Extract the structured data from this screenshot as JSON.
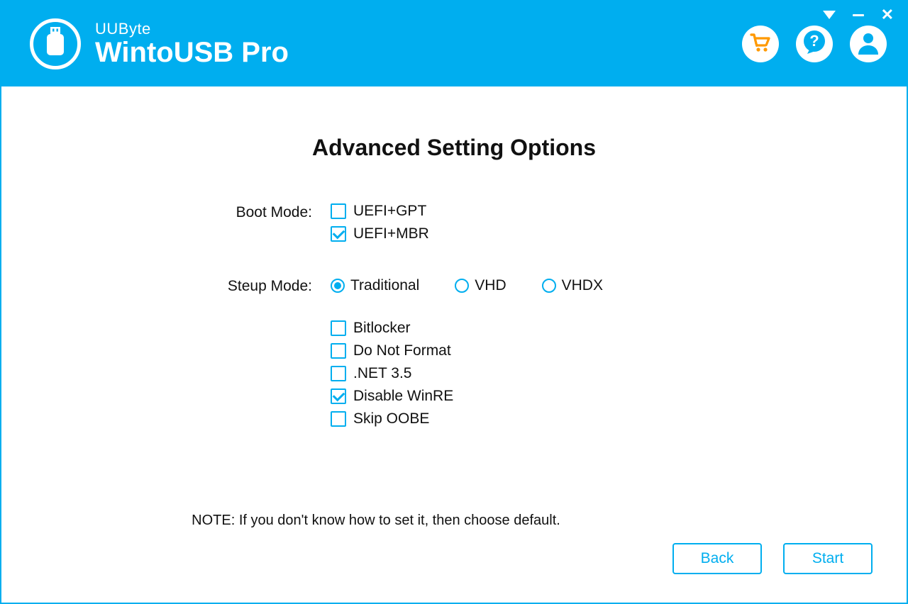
{
  "brand": {
    "company": "UUByte",
    "product": "WintoUSB Pro"
  },
  "colors": {
    "brand": "#00aeef",
    "cart": "#ff9900"
  },
  "page": {
    "title": "Advanced Setting Options",
    "note": "NOTE: If you don't know how to set it, then choose default."
  },
  "labels": {
    "boot_mode": "Boot Mode:",
    "setup_mode": "Steup Mode:"
  },
  "boot_mode": {
    "options": [
      {
        "key": "uefi_gpt",
        "label": "UEFI+GPT",
        "checked": false
      },
      {
        "key": "uefi_mbr",
        "label": "UEFI+MBR",
        "checked": true
      }
    ]
  },
  "setup_mode": {
    "selected": "traditional",
    "options": [
      {
        "key": "traditional",
        "label": "Traditional"
      },
      {
        "key": "vhd",
        "label": "VHD"
      },
      {
        "key": "vhdx",
        "label": "VHDX"
      }
    ]
  },
  "extra_options": [
    {
      "key": "bitlocker",
      "label": "Bitlocker",
      "checked": false
    },
    {
      "key": "no_format",
      "label": "Do Not Format",
      "checked": false
    },
    {
      "key": "net35",
      "label": ".NET 3.5",
      "checked": false
    },
    {
      "key": "disable_winre",
      "label": "Disable WinRE",
      "checked": true
    },
    {
      "key": "skip_oobe",
      "label": "Skip OOBE",
      "checked": false
    }
  ],
  "buttons": {
    "back": "Back",
    "start": "Start"
  }
}
